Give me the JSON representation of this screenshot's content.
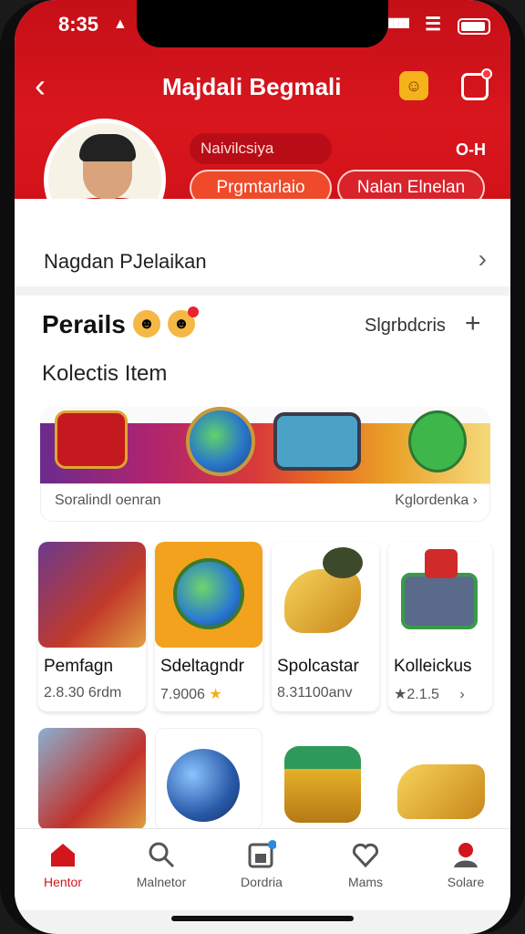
{
  "status": {
    "time": "8:35"
  },
  "header": {
    "title": "Majdali Begmali",
    "subtitle_pill": "Naivilcsiya",
    "right_text": "O-H",
    "btn1": "Prgmtarlaio",
    "btn2": "Nalan Elnelan"
  },
  "profile": {
    "name": "Nagdan PJelaikan"
  },
  "section": {
    "title": "Perails",
    "action": "Slgrbdcris",
    "subtitle": "Kolectis Item"
  },
  "banner": {
    "left": "Soralindl oenran",
    "right": "Kglordenka"
  },
  "items": [
    {
      "name": "Pemfagn",
      "value": "2.8.30 6rdm"
    },
    {
      "name": "Sdeltagndr",
      "value": "7.9006"
    },
    {
      "name": "Spolcastar",
      "value": "8.31100anv"
    },
    {
      "name": "Kolleickus",
      "value": "2.1.5"
    }
  ],
  "nav": [
    {
      "label": "Hentor",
      "icon": "home-icon"
    },
    {
      "label": "Malnetor",
      "icon": "search-icon"
    },
    {
      "label": "Dordria",
      "icon": "save-icon"
    },
    {
      "label": "Mams",
      "icon": "heart-icon"
    },
    {
      "label": "Solare",
      "icon": "profile-icon"
    }
  ],
  "colors": {
    "brand": "#d2161d",
    "accent": "#ef4a2a"
  }
}
